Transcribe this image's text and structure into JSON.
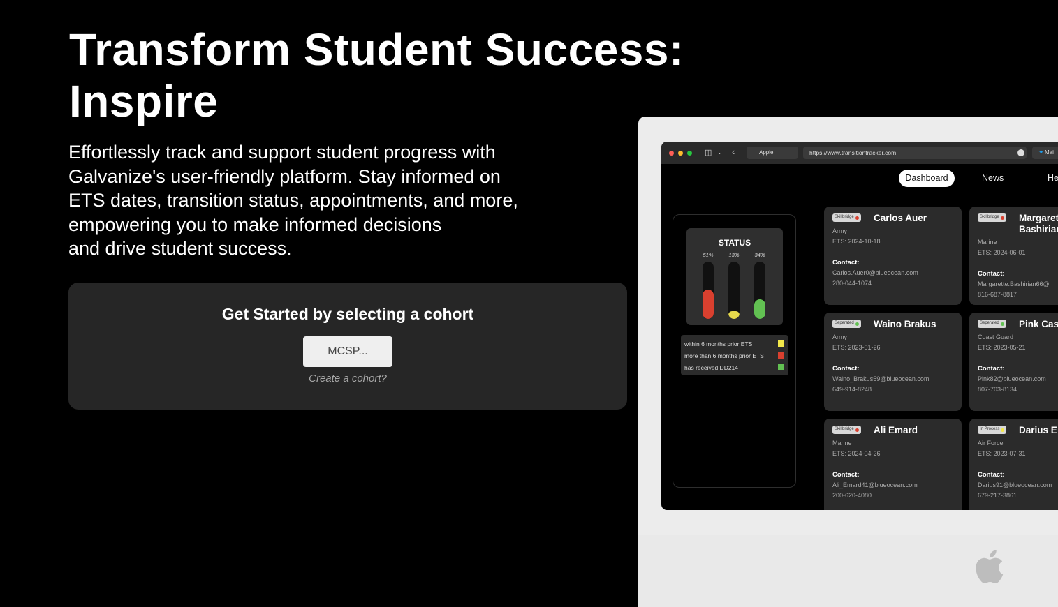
{
  "hero": {
    "title_line1": "Transform Student Success:",
    "title_line2": "Inspire",
    "description_lines": [
      "Effortlessly track and support student progress with",
      "Galvanize's user-friendly platform. Stay informed on",
      "ETS dates, transition status, appointments, and more,",
      "empowering you to make informed decisions",
      "and drive student success."
    ]
  },
  "cohort": {
    "heading": "Get Started by selecting a cohort",
    "select_label": "MCSP...",
    "create_link": "Create a cohort?"
  },
  "mockup": {
    "browser": {
      "tab_label": "Apple",
      "url": "https://www.transitiontracker.com",
      "twitter_tab": "Mai",
      "colors": {
        "close": "#ff5f57",
        "minimize": "#febc2e",
        "zoom": "#28c840"
      }
    },
    "nav": {
      "active": "Dashboard",
      "news": "News",
      "help": "He"
    },
    "status": {
      "title": "STATUS",
      "bars": [
        {
          "pct": "51%",
          "level": 0.51,
          "color": "#d9402f"
        },
        {
          "pct": "13%",
          "level": 0.13,
          "color": "#e6d84c"
        },
        {
          "pct": "34%",
          "level": 0.34,
          "color": "#62c152"
        }
      ],
      "legend": [
        {
          "label": "within 6 months prior ETS",
          "color": "#f2e84a"
        },
        {
          "label": "more than 6 months prior ETS",
          "color": "#d9402f"
        },
        {
          "label": "has received DD214",
          "color": "#62c152"
        }
      ]
    },
    "students": [
      {
        "badge": "Skillbridge",
        "badge_color": "#d9402f",
        "name_line1": "Carlos Auer",
        "name_line2": "",
        "branch": "Army",
        "ets": "ETS: 2024-10-18",
        "contact_label": "Contact:",
        "email": "Carlos.Auer0@blueocean.com",
        "phone": "280-044-1074"
      },
      {
        "badge": "Skillbridge",
        "badge_color": "#d9402f",
        "name_line1": "Margaret",
        "name_line2": "Bashirian",
        "branch": "Marine",
        "ets": "ETS: 2024-06-01",
        "contact_label": "Contact:",
        "email": "Margarette.Bashirian66@",
        "phone": "816-687-8817"
      },
      {
        "badge": "Seperated",
        "badge_color": "#62c152",
        "name_line1": "Waino Brakus",
        "name_line2": "",
        "branch": "Army",
        "ets": "ETS: 2023-01-26",
        "contact_label": "Contact:",
        "email": "Waino_Brakus59@blueocean.com",
        "phone": "649-914-8248"
      },
      {
        "badge": "Seperated",
        "badge_color": "#62c152",
        "name_line1": "Pink Cas",
        "name_line2": "",
        "branch": "Coast Guard",
        "ets": "ETS: 2023-05-21",
        "contact_label": "Contact:",
        "email": "Pink82@blueocean.com",
        "phone": "807-703-8134"
      },
      {
        "badge": "Skillbridge",
        "badge_color": "#d9402f",
        "name_line1": "Ali Emard",
        "name_line2": "",
        "branch": "Marine",
        "ets": "ETS: 2024-04-26",
        "contact_label": "Contact:",
        "email": "Ali_Emard41@blueocean.com",
        "phone": "200-620-4080"
      },
      {
        "badge": "In Process",
        "badge_color": "#f2e84a",
        "name_line1": "Darius E",
        "name_line2": "",
        "branch": "Air Force",
        "ets": "ETS: 2023-07-31",
        "contact_label": "Contact:",
        "email": "Darius91@blueocean.com",
        "phone": "679-217-3861"
      }
    ]
  }
}
